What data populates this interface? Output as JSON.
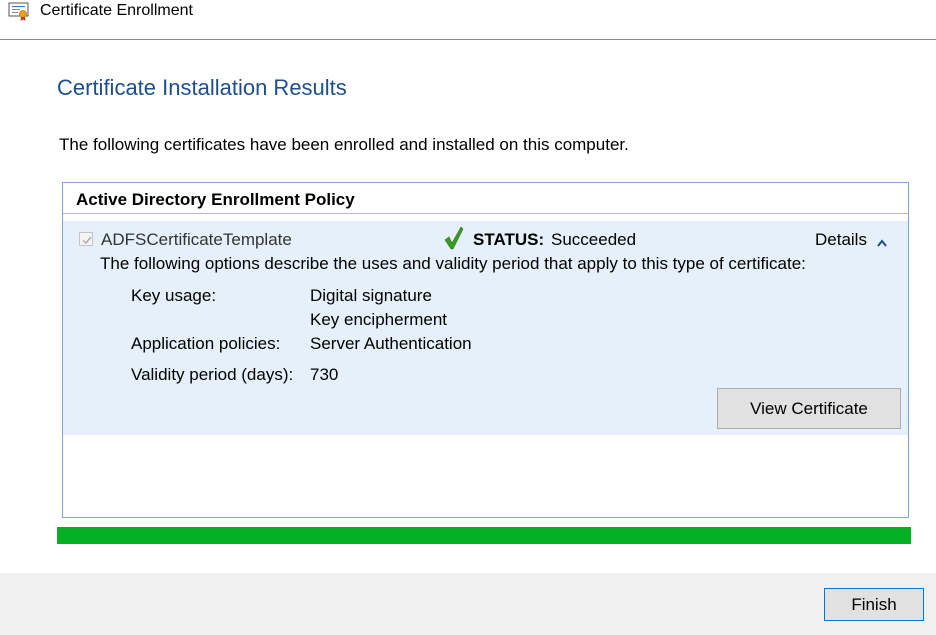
{
  "window": {
    "title": "Certificate Enrollment",
    "icon": "certificate-icon"
  },
  "heading": "Certificate Installation Results",
  "intro": "The following certificates have been enrolled and installed on this computer.",
  "policy": {
    "name": "Active Directory Enrollment Policy",
    "certificate": {
      "template": "ADFSCertificateTemplate",
      "checked": true,
      "status_label": "STATUS:",
      "status_value": "Succeeded",
      "status_icon": "green-checkmark-icon",
      "details_label": "Details",
      "details_icon": "chevron-up-icon",
      "description": "The following options describe the uses and validity period that apply to this type of certificate:",
      "properties": [
        {
          "label": "Key usage:",
          "values": [
            "Digital signature",
            "Key encipherment"
          ]
        },
        {
          "label": "Application policies:",
          "values": [
            "Server Authentication"
          ]
        },
        {
          "label": "Validity period (days):",
          "values": [
            "730"
          ]
        }
      ],
      "view_button": "View Certificate"
    }
  },
  "progress": {
    "percent": 100,
    "color": "#06b025"
  },
  "footer": {
    "finish_button": "Finish"
  },
  "colors": {
    "heading": "#1e4e8c",
    "selection_background": "#e5f0fb",
    "box_border": "#7aa7d6",
    "button_focus_border": "#0078d7"
  }
}
